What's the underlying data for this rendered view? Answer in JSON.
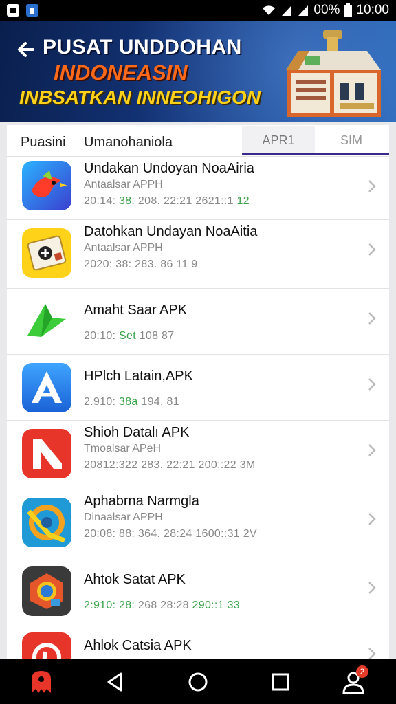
{
  "status_bar": {
    "battery": "00%",
    "time": "10:00"
  },
  "banner": {
    "line1": "PUSAT UNDDOHAN",
    "line2": "INDONEASIN",
    "line3": "INBSATKAN INNEOHIGON"
  },
  "list_header": {
    "col1": "Puasini",
    "col2": "Umanohaniola",
    "tabs": [
      "APR1",
      "SIM"
    ],
    "active_tab": "APR1"
  },
  "apps": [
    {
      "icon": "bird-app-icon",
      "title": "Undakan Undoyan NoaAiria",
      "subtitle": "Antaalsar APPH",
      "meta": [
        {
          "t": "20:14: ",
          "g": false
        },
        {
          "t": "38: ",
          "g": true
        },
        {
          "t": "208. 22:21 ",
          "g": false
        },
        {
          "t": "2621::1 ",
          "g": false
        },
        {
          "t": "12",
          "g": true
        }
      ]
    },
    {
      "icon": "ticket-app-icon",
      "title": "Datohkan Undayan NoaAitia",
      "subtitle": "Antaalsar APPH",
      "meta": [
        {
          "t": "2020: 38: 283. 86 11 ",
          "g": false
        },
        {
          "t": "9",
          "g": false
        }
      ]
    },
    {
      "icon": "arrow-app-icon",
      "title": "Amaht Saar APK",
      "subtitle": "",
      "meta": [
        {
          "t": "20:10: ",
          "g": false
        },
        {
          "t": "Set ",
          "g": true
        },
        {
          "t": "108 ",
          "g": false
        },
        {
          "t": "87",
          "g": false
        }
      ]
    },
    {
      "icon": "blue-a-app-icon",
      "title": "HPlch Latain,APK",
      "subtitle": "",
      "meta": [
        {
          "t": "2.910: ",
          "g": false
        },
        {
          "t": "38a ",
          "g": true
        },
        {
          "t": "194. 81",
          "g": false
        }
      ]
    },
    {
      "icon": "red-n-app-icon",
      "title": "Shioh Datalı APK",
      "subtitle": "Tmoalsar APeH",
      "meta": [
        {
          "t": "20812:322 283. 22:21 200::22 ",
          "g": false
        },
        {
          "t": "3M",
          "g": false
        }
      ]
    },
    {
      "icon": "swirl-app-icon",
      "title": "Aphabrna Narmgla",
      "subtitle": "Dinaalsar APPH",
      "meta": [
        {
          "t": "20:08: ",
          "g": false
        },
        {
          "t": "88: ",
          "g": false
        },
        {
          "t": "364. 28:24 1600::31 2V",
          "g": false
        }
      ]
    },
    {
      "icon": "chrome-like-app-icon",
      "title": "Ahtok Satat APK",
      "subtitle": "",
      "meta": [
        {
          "t": "2:910: 28: ",
          "g": true
        },
        {
          "t": "268 28:28 ",
          "g": false
        },
        {
          "t": "290::1 33",
          "g": true
        }
      ]
    },
    {
      "icon": "pinterest-like-app-icon",
      "title": "Ahlok Catsia APK",
      "subtitle": "",
      "meta": []
    }
  ],
  "nav": {
    "badge": "2"
  },
  "colors": {
    "banner_dark": "#0a1f4d",
    "orange": "#ff6a1a",
    "yellow": "#ffd21a",
    "meta_green": "#3aa34a",
    "tab_underline": "#3a2a8c"
  }
}
